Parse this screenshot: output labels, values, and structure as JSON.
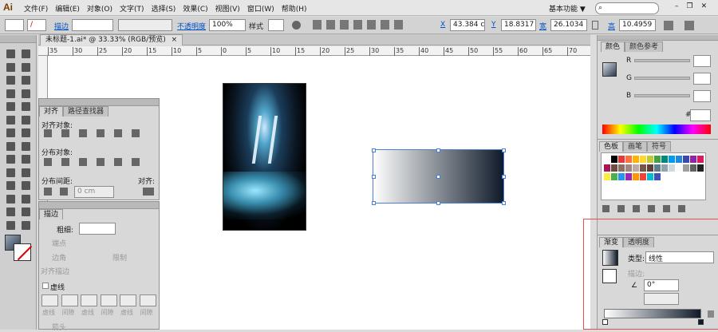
{
  "app": {
    "logo": "Ai",
    "workspace": "基本功能",
    "workspace_arrow": "▼",
    "search_icon": "search-icon"
  },
  "menu": [
    "文件(F)",
    "编辑(E)",
    "对象(O)",
    "文字(T)",
    "选择(S)",
    "效果(C)",
    "视图(V)",
    "窗口(W)",
    "帮助(H)"
  ],
  "control": {
    "stroke_label": "描边",
    "opacity_label": "不透明度",
    "opacity_value": "100%",
    "style_label": "样式",
    "x_label": "X",
    "x_value": "43.384 c",
    "y_label": "Y",
    "y_value": "18.8317",
    "w_label": "宽",
    "w_value": "26.1034",
    "h_label": "高",
    "h_value": "10.4959"
  },
  "doc_tab": {
    "title": "未标题-1.ai* @ 33.33% (RGB/预览)",
    "close": "×"
  },
  "ruler": {
    "ticks": [
      "35",
      "30",
      "25",
      "20",
      "15",
      "10",
      "5",
      "0",
      "5",
      "10",
      "15",
      "20",
      "25",
      "30",
      "35",
      "40",
      "45",
      "50",
      "55",
      "60",
      "65",
      "70"
    ]
  },
  "align_panel": {
    "tabs": [
      "对齐",
      "路径查找器"
    ],
    "align_objects": "对齐对象:",
    "distribute_objects": "分布对象:",
    "distribute_spacing": "分布间距:",
    "align_to": "对齐:",
    "spacing_value": "0 cm"
  },
  "stroke_panel": {
    "tab": "描边",
    "weight_label": "粗细:",
    "end_label": "端点",
    "corner_label": "边角",
    "limit_label": "限制",
    "align_label": "对齐描边",
    "dashed_label": "虚线",
    "dash_labels": [
      "虚线",
      "间隙",
      "虚线",
      "间隙",
      "虚线",
      "间隙"
    ],
    "arrow_label": "箭头"
  },
  "color_panel": {
    "tabs": [
      "颜色",
      "颜色参考"
    ],
    "channels": [
      "R",
      "G",
      "B"
    ],
    "hex_label": "#"
  },
  "swatch_panel": {
    "tabs": [
      "色板",
      "画笔",
      "符号"
    ]
  },
  "gradient_panel": {
    "tabs": [
      "渐变",
      "透明度"
    ],
    "type_label": "类型:",
    "type_value": "线性",
    "stroke_label": "描边:",
    "angle_value": "0°",
    "gradient_start": "#ffffff",
    "gradient_end": "#0f1a2a"
  },
  "colors": {
    "accent": "#0050c8",
    "selection": "#4a7fd6",
    "highlight_box": "#e05050"
  }
}
